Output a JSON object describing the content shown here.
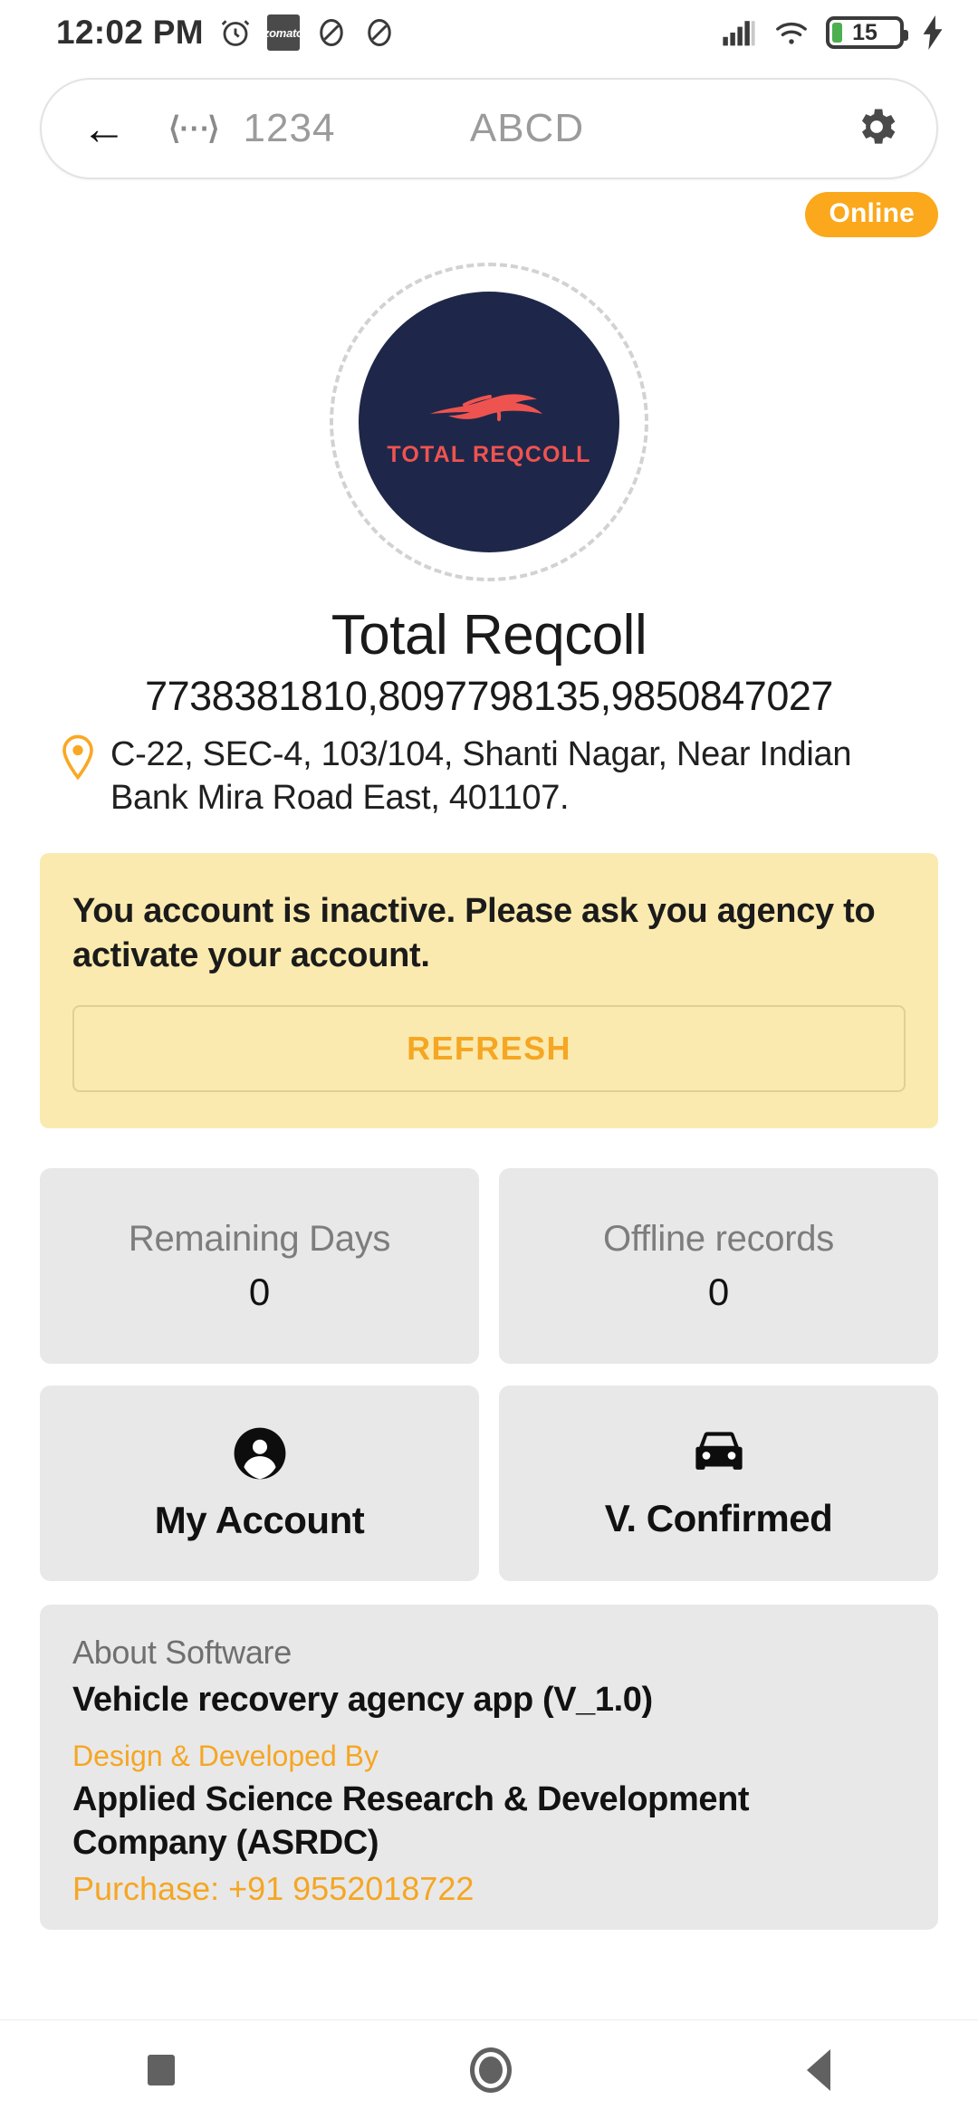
{
  "status_bar": {
    "time": "12:02 PM",
    "alarm_icon": "alarm-icon",
    "zomato_label": "zomato",
    "app_icon_1": "app-notification-icon",
    "app_icon_2": "app-notification-icon",
    "signal_icon": "cellular-signal-icon",
    "wifi_icon": "wifi-icon",
    "battery_level": "15",
    "battery_charging_icon": "charging-bolt-icon"
  },
  "topbar": {
    "back_icon": "back-arrow-icon",
    "code_icon": "code-brackets-icon",
    "number_field": "1234",
    "letters_field": "ABCD",
    "settings_icon": "gear-icon"
  },
  "status_badge": {
    "label": "Online",
    "color": "#FBA81C"
  },
  "logo": {
    "wordmark": "TOTAL REQCOLL",
    "car_icon": "sports-car-icon",
    "circle_color": "#1E2749",
    "accent_color": "#EF5350"
  },
  "business": {
    "name": "Total Reqcoll",
    "phones": "7738381810,8097798135,9850847027",
    "location_icon": "location-pin-icon",
    "address": "C-22, SEC-4, 103/104, Shanti Nagar, Near Indian Bank Mira Road East, 401107."
  },
  "alert": {
    "message": "You account is inactive. Please ask you agency to activate your account.",
    "refresh_label": "REFRESH",
    "background": "#FBEAAF",
    "accent": "#F5A623"
  },
  "stats": [
    {
      "label": "Remaining Days",
      "value": "0"
    },
    {
      "label": "Offline records",
      "value": "0"
    }
  ],
  "actions": [
    {
      "label": "My Account",
      "icon": "person-icon"
    },
    {
      "label": "V. Confirmed",
      "icon": "car-icon"
    }
  ],
  "about": {
    "heading": "About Software",
    "app": "Vehicle recovery agency app (V_1.0)",
    "developed_by_label": "Design & Developed By",
    "developer": "Applied Science Research & Development Company (ASRDC)",
    "purchase": "Purchase: +91 9552018722"
  },
  "navbar": {
    "recents_icon": "square-recents-icon",
    "home_icon": "circle-home-icon",
    "back_icon": "triangle-back-icon"
  }
}
